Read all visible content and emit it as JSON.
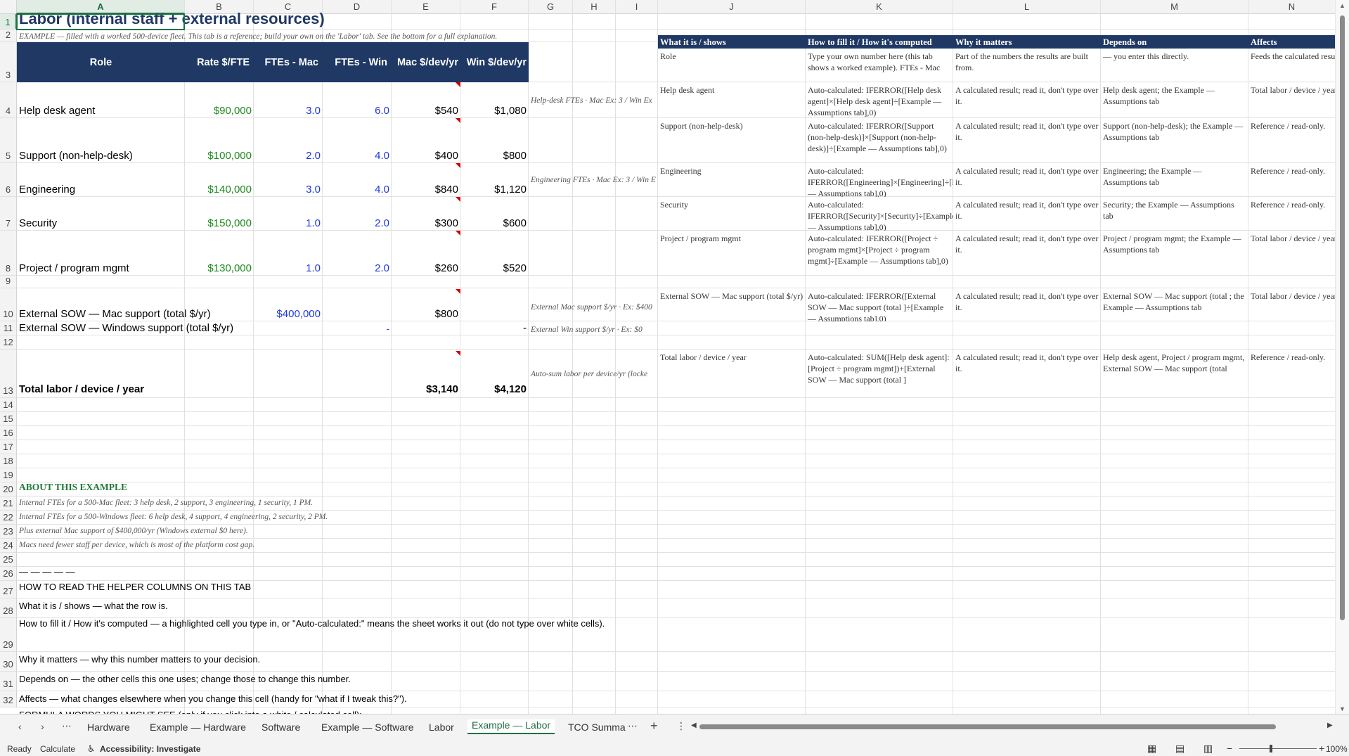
{
  "columns": [
    "A",
    "B",
    "C",
    "D",
    "E",
    "F",
    "G",
    "H",
    "I",
    "J",
    "K",
    "L",
    "M",
    "N"
  ],
  "rows": [
    "1",
    "2",
    "3",
    "4",
    "5",
    "6",
    "7",
    "8",
    "9",
    "10",
    "11",
    "12",
    "13",
    "14",
    "15",
    "16",
    "17",
    "18",
    "19",
    "20",
    "21",
    "22",
    "23",
    "24",
    "25",
    "26",
    "27",
    "28",
    "29",
    "30",
    "31",
    "32"
  ],
  "title": "Labor (internal staff + external resources)",
  "subtitle": "EXAMPLE — filled with a worked 500-device fleet. This tab is a reference; build your own on the 'Labor' tab. See the bottom for a full explanation.",
  "table_headers": [
    "Role",
    "Rate $/FTE",
    "FTEs - Mac",
    "FTEs - Win",
    "Mac $/dev/yr",
    "Win $/dev/yr"
  ],
  "roles": [
    {
      "role": "Help desk agent",
      "rate": "$90,000",
      "mac": "3.0",
      "win": "6.0",
      "mac_dev": "$540",
      "win_dev": "$1,080",
      "note": "Help-desk FTEs · Mac Ex: 3 / Win Ex"
    },
    {
      "role": "Support (non-help-desk)",
      "rate": "$100,000",
      "mac": "2.0",
      "win": "4.0",
      "mac_dev": "$400",
      "win_dev": "$800",
      "note": ""
    },
    {
      "role": "Engineering",
      "rate": "$140,000",
      "mac": "3.0",
      "win": "4.0",
      "mac_dev": "$840",
      "win_dev": "$1,120",
      "note": "Engineering FTEs · Mac Ex: 3 / Win E"
    },
    {
      "role": "Security",
      "rate": "$150,000",
      "mac": "1.0",
      "win": "2.0",
      "mac_dev": "$300",
      "win_dev": "$600",
      "note": ""
    },
    {
      "role": "Project / program mgmt",
      "rate": "$130,000",
      "mac": "1.0",
      "win": "2.0",
      "mac_dev": "$260",
      "win_dev": "$520",
      "note": ""
    }
  ],
  "external_mac": {
    "label": "External SOW — Mac support (total $/yr)",
    "total": "$400,000",
    "mac_dev": "$800",
    "note": "External Mac support $/yr · Ex: $400"
  },
  "external_win": {
    "label": "External SOW — Windows support (total $/yr)",
    "total": "-",
    "win_dev": "-",
    "note": "External Win support $/yr · Ex: $0"
  },
  "total": {
    "label": "Total labor / device / year",
    "mac": "$3,140",
    "win": "$4,120",
    "note": "Auto-sum labor per device/yr (locke"
  },
  "helper_headers": [
    "What it is / shows",
    "How to fill it / How it's computed",
    "Why it matters",
    "Depends on",
    "Affects"
  ],
  "helper_rows": [
    {
      "what": "Role",
      "how": "Type your own number here (this tab shows a worked example). FTEs - Mac",
      "why": "Part of the numbers the results are built from.",
      "dep": "— you enter this directly.",
      "aff": "Feeds the calculated results on other tabs that read this."
    },
    {
      "what": "Help desk agent",
      "how": "Auto-calculated: IFERROR([Help desk agent]×[Help desk agent]÷[Example — Assumptions tab],0)",
      "why": "A calculated result; read it, don't type over it.",
      "dep": "Help desk agent; the Example — Assumptions tab",
      "aff": "Total labor / device / year"
    },
    {
      "what": "Support (non-help-desk)",
      "how": "Auto-calculated: IFERROR([Support (non-help-desk)]×[Support (non-help-desk)]÷[Example — Assumptions tab],0)",
      "why": "A calculated result; read it, don't type over it.",
      "dep": "Support (non-help-desk); the Example — Assumptions tab",
      "aff": "Reference / read-only."
    },
    {
      "what": "Engineering",
      "how": "Auto-calculated: IFERROR([Engineering]×[Engineering]÷[Example — Assumptions tab],0)",
      "why": "A calculated result; read it, don't type over it.",
      "dep": "Engineering; the Example — Assumptions tab",
      "aff": "Reference / read-only."
    },
    {
      "what": "Security",
      "how": "Auto-calculated: IFERROR([Security]×[Security]÷[Example — Assumptions tab],0)",
      "why": "A calculated result; read it, don't type over it.",
      "dep": "Security; the Example — Assumptions tab",
      "aff": "Reference / read-only."
    },
    {
      "what": "Project / program mgmt",
      "how": "Auto-calculated: IFERROR([Project ÷ program mgmt]×[Project ÷ program mgmt]÷[Example — Assumptions tab],0)",
      "why": "A calculated result; read it, don't type over it.",
      "dep": "Project / program mgmt; the Example — Assumptions tab",
      "aff": "Total labor / device / year"
    },
    {
      "what": "External SOW — Mac support (total $/yr)",
      "how": "Auto-calculated: IFERROR([External SOW — Mac support (total ]÷[Example — Assumptions tab],0)",
      "why": "A calculated result; read it, don't type over it.",
      "dep": "External SOW — Mac support (total ; the Example — Assumptions tab",
      "aff": "Total labor / device / year"
    },
    {
      "what": "Total labor / device / year",
      "how": "Auto-calculated: SUM([Help desk agent]:[Project ÷ program mgmt])+[External SOW — Mac support (total ]",
      "why": "A calculated result; read it, don't type over it.",
      "dep": "Help desk agent, Project / program mgmt, External SOW — Mac support (total",
      "aff": "Reference / read-only."
    }
  ],
  "about": {
    "heading": "ABOUT THIS EXAMPLE",
    "lines": [
      "Internal FTEs for a 500-Mac fleet: 3 help desk, 2 support, 3 engineering, 1 security, 1 PM.",
      "Internal FTEs for a 500-Windows fleet: 6 help desk, 4 support, 4 engineering, 2 security, 2 PM.",
      "Plus external Mac support of $400,000/yr (Windows external $0 here).",
      "Macs need fewer staff per device, which is most of the platform cost gap."
    ]
  },
  "dashes": "— — — — —",
  "howto": {
    "heading": "HOW TO READ THE HELPER COLUMNS ON THIS TAB",
    "lines": [
      "What it is / shows — what the row is.",
      "How to fill it / How it's computed — a highlighted cell you type in, or \"Auto-calculated:\" means the sheet works it out (do not type over white cells).",
      "Why it matters — why this number matters to your decision.",
      "Depends on — the other cells this one uses; change those to change this number.",
      "Affects — what changes elsewhere when you change this cell (handy for \"what if I tweak this?\").",
      "FORMULA WORDS YOU MIGHT SEE (only if you click into a white / calculated cell):"
    ]
  },
  "sheet_tabs": [
    "Hardware",
    "Example — Hardware",
    "Software",
    "Example — Software",
    "Labor",
    "Example — Labor",
    "TCO Summa"
  ],
  "active_tab": "Example — Labor",
  "status": {
    "ready": "Ready",
    "calculate": "Calculate",
    "accessibility": "Accessibility: Investigate",
    "zoom": "100%"
  },
  "colors": {
    "header_band": "#1f3864",
    "rate_green": "#1e8a1e",
    "input_blue": "#2038e0",
    "accent": "#1f7245"
  }
}
